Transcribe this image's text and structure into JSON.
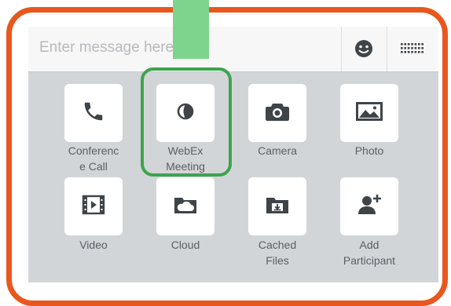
{
  "composer": {
    "placeholder": "Enter message here",
    "emoji_icon": "smiley-icon",
    "keyboard_icon": "keyboard-icon"
  },
  "attachments": [
    {
      "label": "Conferenc\ne Call",
      "icon": "phone-icon"
    },
    {
      "label": "WebEx\nMeeting",
      "icon": "webex-icon"
    },
    {
      "label": "Camera",
      "icon": "camera-icon"
    },
    {
      "label": "Photo",
      "icon": "photo-icon"
    },
    {
      "label": "Video",
      "icon": "video-icon"
    },
    {
      "label": "Cloud",
      "icon": "cloud-folder-icon"
    },
    {
      "label": "Cached\nFiles",
      "icon": "cached-files-icon"
    },
    {
      "label": "Add\nParticipant",
      "icon": "add-participant-icon"
    }
  ],
  "annotation": {
    "frame_color": "#e8571e",
    "highlight_color": "#3fa34d",
    "pointer_color": "#7ed48d"
  },
  "colors": {
    "panel_bg": "#d2d5d8",
    "tile_bg": "#ffffff",
    "icon": "#3f4448",
    "label": "#5b5e62"
  }
}
